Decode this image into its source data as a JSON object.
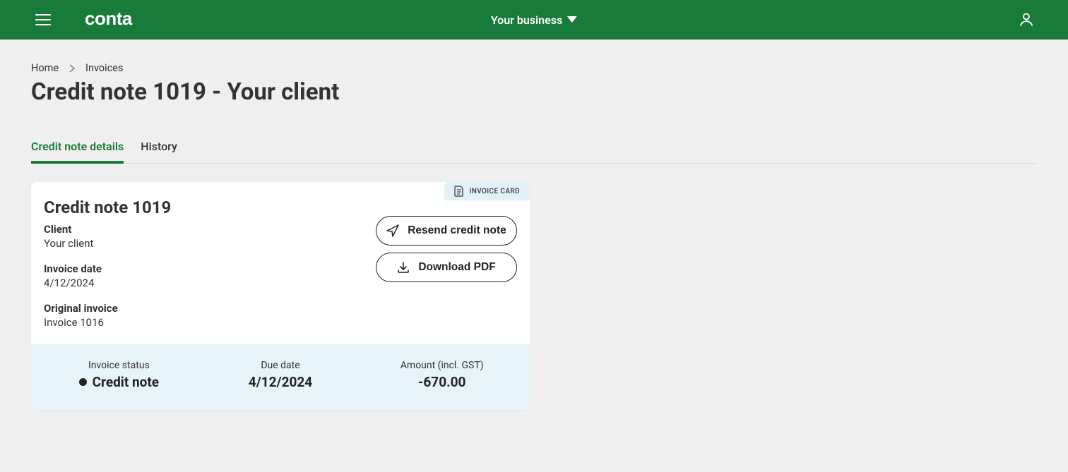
{
  "header": {
    "business_label": "Your business"
  },
  "breadcrumb": {
    "home": "Home",
    "invoices": "Invoices"
  },
  "page_title": "Credit note 1019 - Your client",
  "tabs": {
    "details": "Credit note details",
    "history": "History"
  },
  "badge": {
    "label": "INVOICE CARD"
  },
  "card": {
    "title": "Credit note 1019",
    "client_label": "Client",
    "client_value": "Your client",
    "invoice_date_label": "Invoice date",
    "invoice_date_value": "4/12/2024",
    "original_invoice_label": "Original invoice",
    "original_invoice_value": "Invoice 1016",
    "actions": {
      "resend": "Resend credit note",
      "download": "Download PDF"
    }
  },
  "footer": {
    "status_label": "Invoice status",
    "status_value": "Credit note",
    "due_label": "Due date",
    "due_value": "4/12/2024",
    "amount_label": "Amount (incl. GST)",
    "amount_value": "-670.00"
  }
}
